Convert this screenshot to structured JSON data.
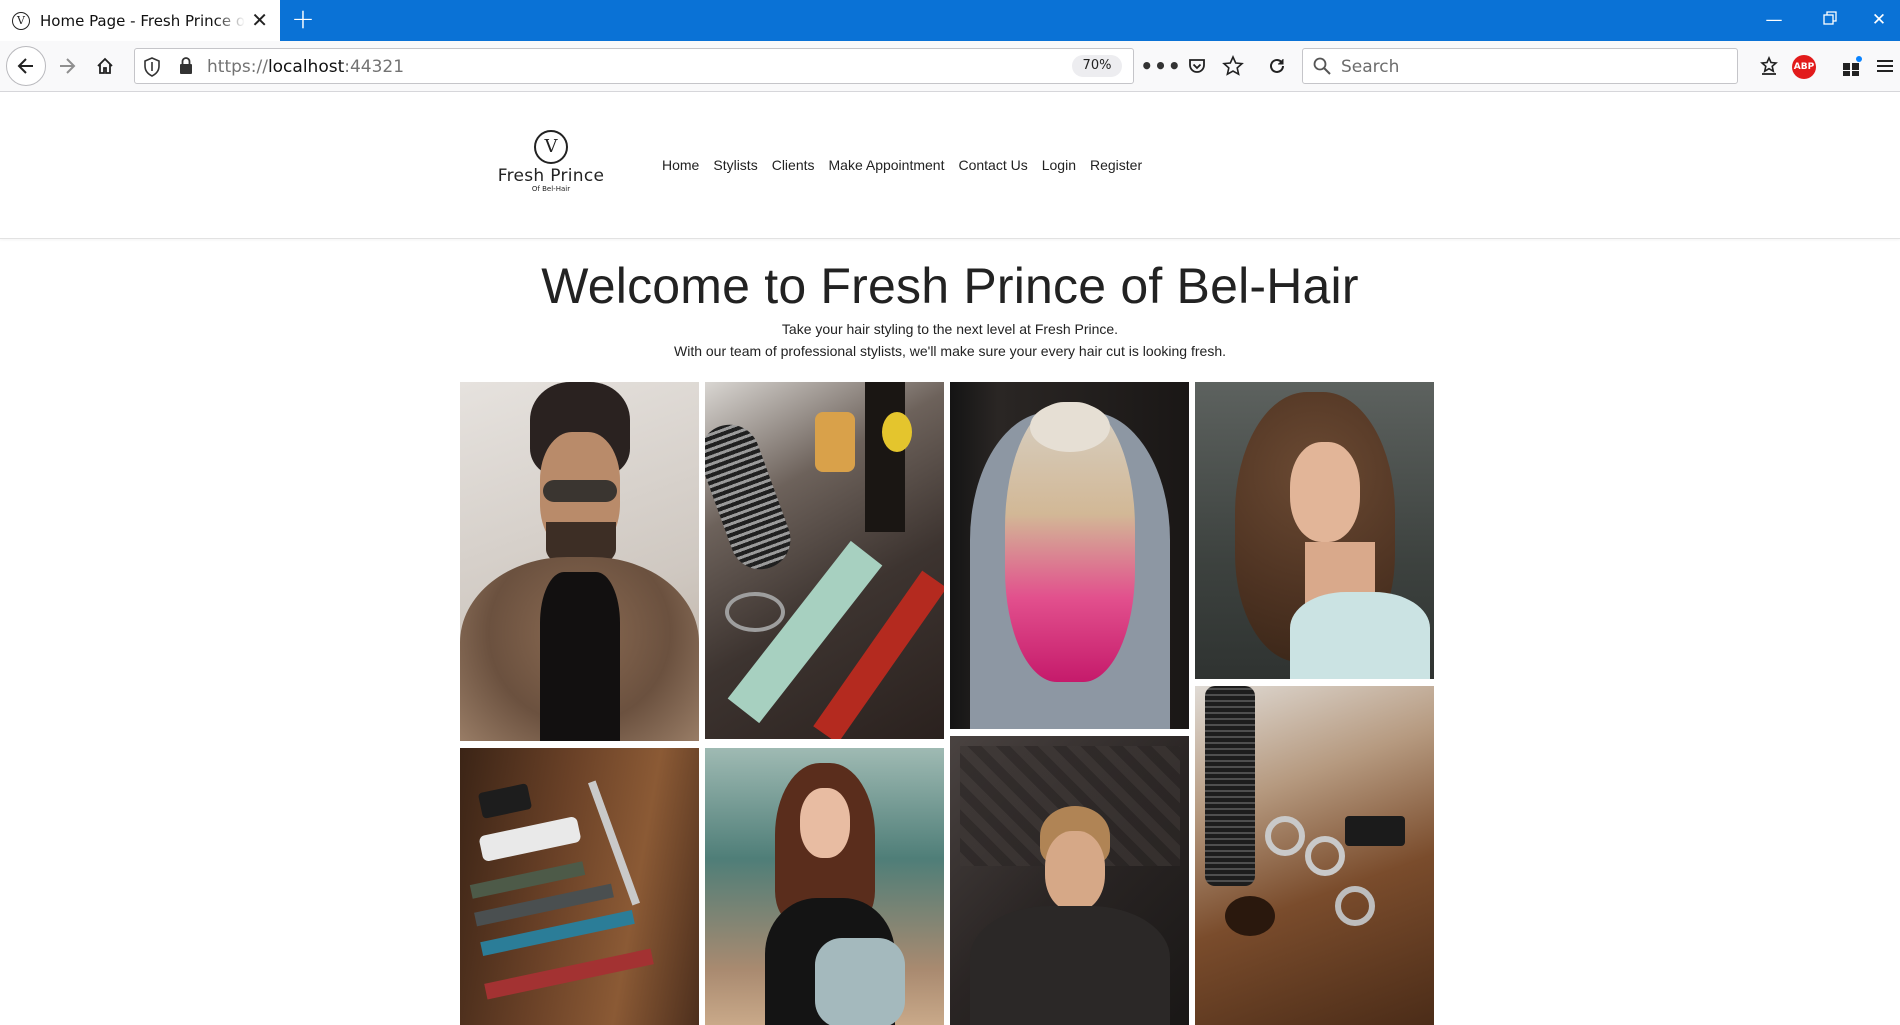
{
  "browser": {
    "tab_title": "Home Page - Fresh Prince of Bel-Hair",
    "tab_icon_glyph": "V",
    "url_scheme": "https://",
    "url_host": "localhost",
    "url_port": ":44321",
    "zoom": "70%",
    "search_placeholder": "Search",
    "abp_label": "ABP"
  },
  "site": {
    "logo_glyph": "V",
    "logo_name": "Fresh Prince",
    "logo_sub": "Of Bel-Hair",
    "nav": [
      "Home",
      "Stylists",
      "Clients",
      "Make Appointment",
      "Contact Us",
      "Login",
      "Register"
    ]
  },
  "hero": {
    "title": "Welcome to Fresh Prince of Bel-Hair",
    "line1": "Take your hair styling to the next level at Fresh Prince.",
    "line2": "With our team of professional stylists, we'll make sure your every hair cut is looking fresh."
  },
  "gallery": [
    {
      "subject": "man-in-fur-coat-photo",
      "bg": "#d8d2cc"
    },
    {
      "subject": "hair-tools-table-photo",
      "bg": "#3a3330"
    },
    {
      "subject": "pink-blonde-hair-photo",
      "bg": "#2a2624"
    },
    {
      "subject": "curly-hair-woman-photo",
      "bg": "#3b3d3a"
    },
    {
      "subject": "combs-and-clippers-photo",
      "bg": "#5a3a24"
    },
    {
      "subject": "woman-outdoors-photo",
      "bg": "#5f8c86"
    },
    {
      "subject": "man-graffiti-wall-photo",
      "bg": "#2d2a29"
    },
    {
      "subject": "scissors-and-brush-photo",
      "bg": "#8a5a35"
    }
  ]
}
